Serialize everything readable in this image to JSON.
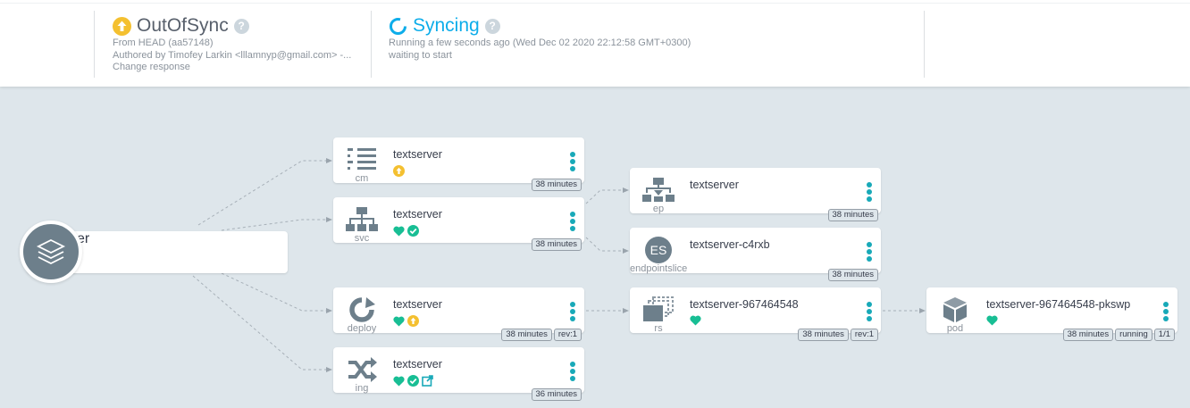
{
  "sync_status": {
    "title": "OutOfSync",
    "lines": [
      "From HEAD (aa57148)",
      "Authored by Timofey Larkin <lllamnyp@gmail.com> -...",
      "Change response"
    ]
  },
  "operation_status": {
    "title": "Syncing",
    "lines": [
      "Running a few seconds ago (Wed Dec 02 2020 22:12:58 GMT+0300)",
      "waiting to start"
    ]
  },
  "colors": {
    "healthy": "#18be94",
    "out_of_sync": "#f4c030",
    "synced": "#18be94",
    "progressing": "#0dadea",
    "menu": "#18a9b8"
  },
  "app": {
    "name": "textserver",
    "icons": [
      "healthy-heart-icon",
      "out-of-sync-icon",
      "external-link-icon"
    ]
  },
  "nodes": {
    "cm": {
      "name": "textserver",
      "kind": "cm",
      "tags": [
        "38 minutes"
      ]
    },
    "svc": {
      "name": "textserver",
      "kind": "svc",
      "tags": [
        "38 minutes"
      ]
    },
    "deploy": {
      "name": "textserver",
      "kind": "deploy",
      "tags": [
        "38 minutes",
        "rev:1"
      ]
    },
    "ing": {
      "name": "textserver",
      "kind": "ing",
      "tags": [
        "36 minutes"
      ]
    },
    "ep": {
      "name": "textserver",
      "kind": "ep",
      "tags": [
        "38 minutes"
      ]
    },
    "endpointslice": {
      "name": "textserver-c4rxb",
      "kind": "endpointslice",
      "badge": "ES",
      "tags": [
        "38 minutes"
      ]
    },
    "rs": {
      "name": "textserver-967464548",
      "kind": "rs",
      "tags": [
        "38 minutes",
        "rev:1"
      ]
    },
    "pod": {
      "name": "textserver-967464548-pkswp",
      "kind": "pod",
      "tags": [
        "38 minutes",
        "running",
        "1/1"
      ]
    }
  }
}
